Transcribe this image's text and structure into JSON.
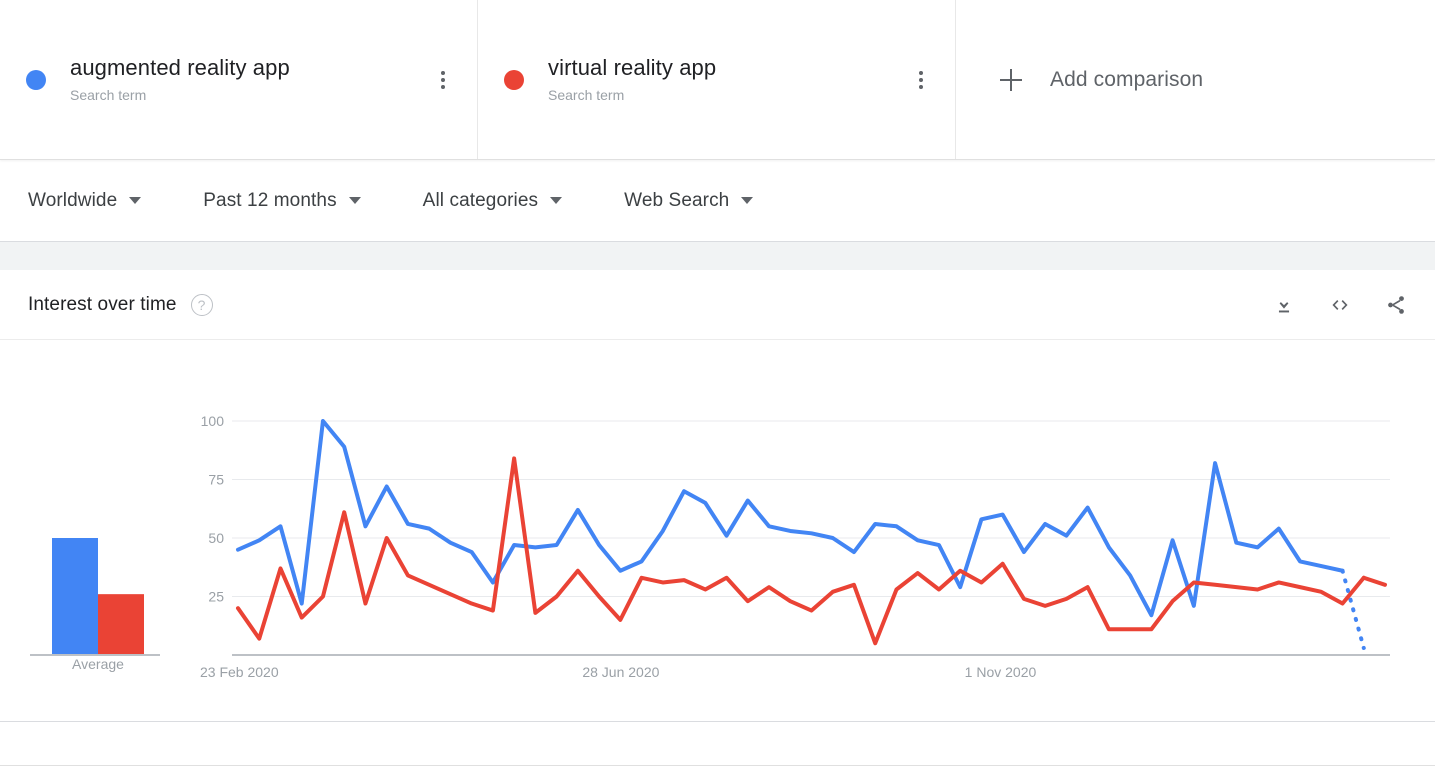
{
  "terms": [
    {
      "title": "augmented reality app",
      "subtitle": "Search term",
      "color": "#4285f4",
      "menu_icon": "more-vert-icon"
    },
    {
      "title": "virtual reality app",
      "subtitle": "Search term",
      "color": "#ea4335",
      "menu_icon": "more-vert-icon"
    }
  ],
  "add_comparison": {
    "label": "Add comparison",
    "icon": "plus-icon"
  },
  "filters": [
    {
      "label": "Worldwide",
      "icon": "chevron-down-icon"
    },
    {
      "label": "Past 12 months",
      "icon": "chevron-down-icon"
    },
    {
      "label": "All categories",
      "icon": "chevron-down-icon"
    },
    {
      "label": "Web Search",
      "icon": "chevron-down-icon"
    }
  ],
  "interest_over_time": {
    "title": "Interest over time",
    "help_icon": "help-circle-icon",
    "help_glyph": "?",
    "actions": [
      {
        "name": "download-icon",
        "label": "Download"
      },
      {
        "name": "embed-code-icon",
        "label": "<>"
      },
      {
        "name": "share-icon",
        "label": "Share"
      }
    ],
    "average_label": "Average"
  },
  "chart_data": {
    "type": "line",
    "title": "Interest over time",
    "xlabel": "",
    "ylabel": "",
    "ylim": [
      0,
      100
    ],
    "yticks": [
      25,
      50,
      75,
      100
    ],
    "grid": true,
    "legend": "none",
    "x_tick_labels": [
      "23 Feb 2020",
      "28 Jun 2020",
      "1 Nov 2020"
    ],
    "x_tick_indices": [
      0,
      18,
      36
    ],
    "partial_last_point": true,
    "series": [
      {
        "name": "augmented reality app",
        "color": "#4285f4",
        "average": 50,
        "values": [
          45,
          49,
          55,
          22,
          100,
          89,
          55,
          72,
          56,
          54,
          48,
          44,
          31,
          47,
          46,
          47,
          62,
          47,
          36,
          40,
          53,
          70,
          65,
          51,
          66,
          55,
          53,
          52,
          50,
          44,
          56,
          55,
          49,
          47,
          29,
          58,
          60,
          44,
          56,
          51,
          63,
          46,
          34,
          17,
          49,
          21,
          82,
          48,
          46,
          54,
          40,
          38,
          36,
          3
        ]
      },
      {
        "name": "virtual reality app",
        "color": "#ea4335",
        "average": 26,
        "values": [
          20,
          7,
          37,
          16,
          25,
          61,
          22,
          50,
          34,
          30,
          26,
          22,
          19,
          84,
          18,
          25,
          36,
          25,
          15,
          33,
          31,
          32,
          28,
          33,
          23,
          29,
          23,
          19,
          27,
          30,
          5,
          28,
          35,
          28,
          36,
          31,
          39,
          24,
          21,
          24,
          29,
          11,
          11,
          11,
          23,
          31,
          30,
          29,
          28,
          31,
          29,
          27,
          22,
          33,
          30
        ]
      }
    ]
  }
}
